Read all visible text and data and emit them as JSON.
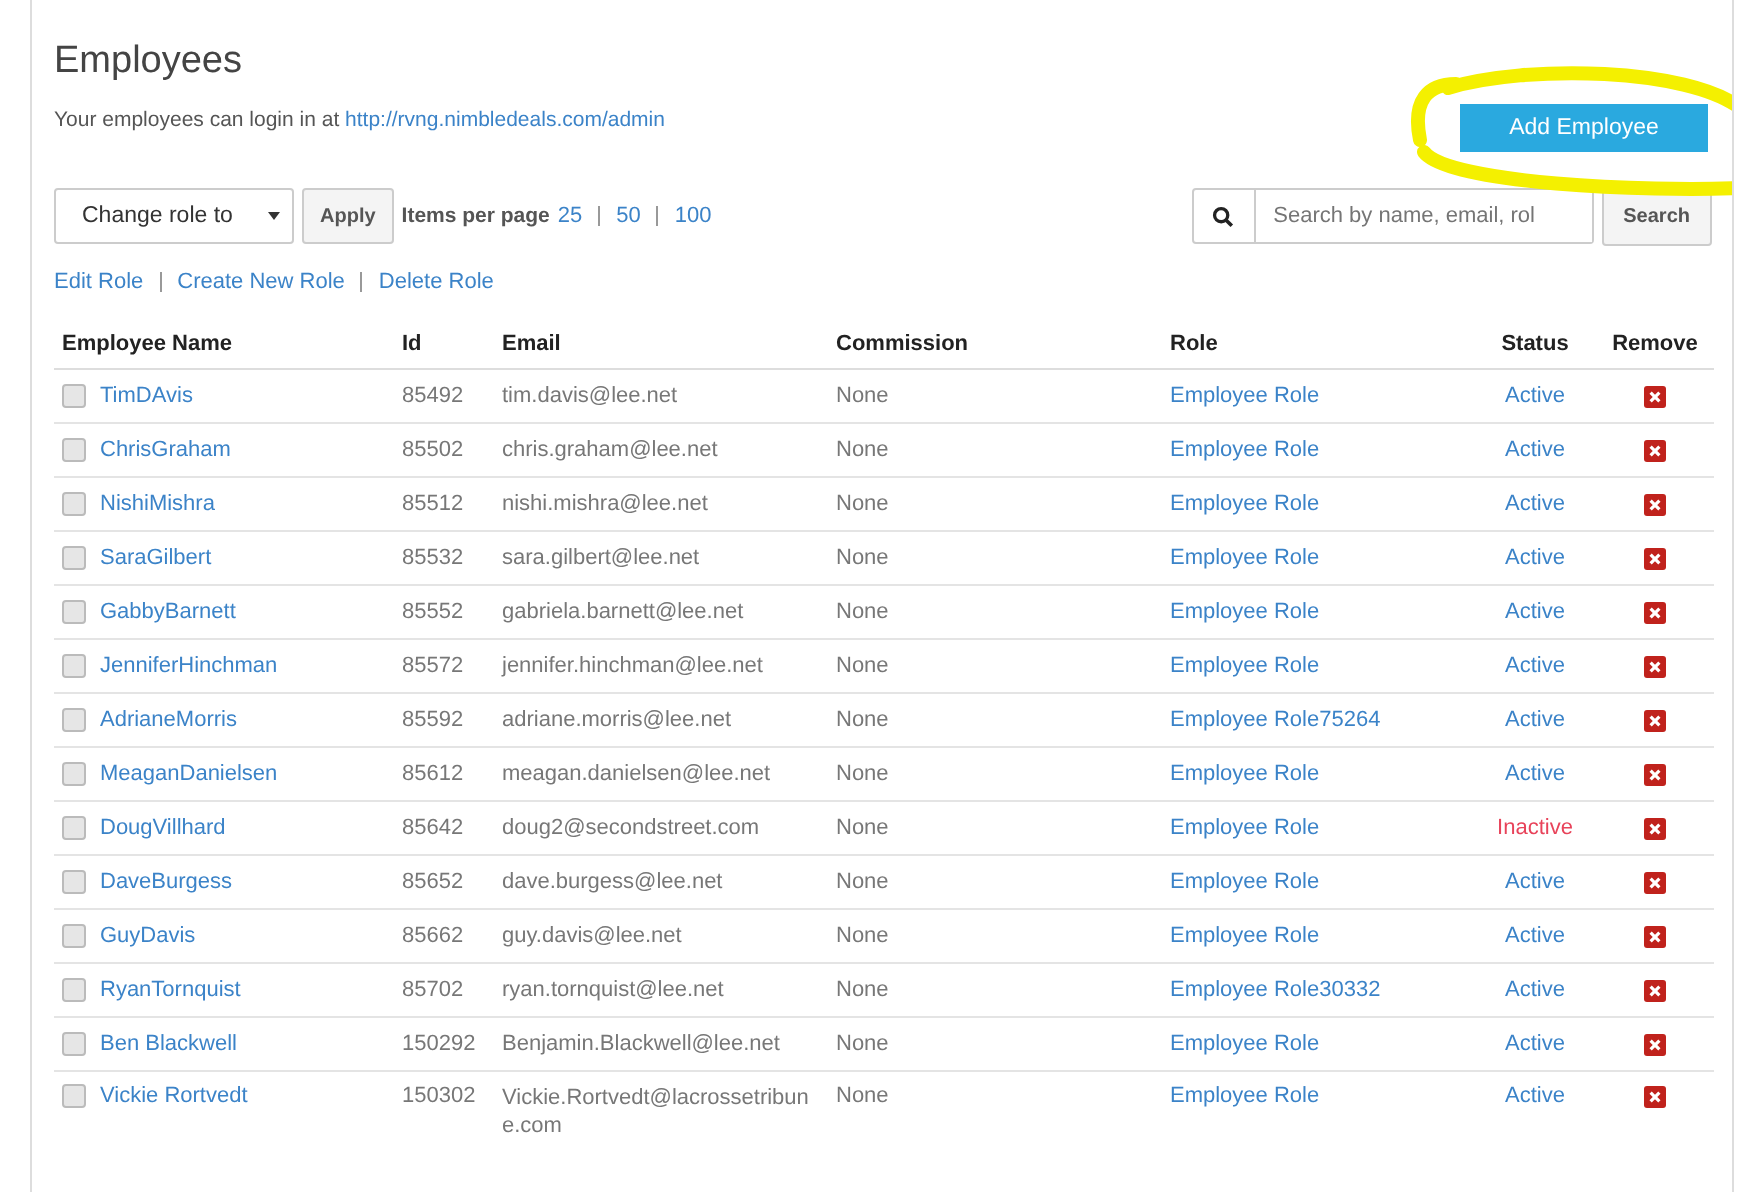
{
  "page": {
    "title": "Employees",
    "login_note": "Your employees can login in at",
    "login_link": "http://rvng.nimbledeals.com/admin",
    "add_button": "Add Employee"
  },
  "toolbar": {
    "role_select": "Change role to",
    "apply_button": "Apply",
    "items_per_page_label": "Items per page",
    "page_sizes": [
      {
        "label": "25"
      },
      {
        "label": "50"
      },
      {
        "label": "100"
      }
    ],
    "search": {
      "placeholder": "Search by name, email, rol"
    },
    "search_button": "Search"
  },
  "role_links": [
    "Edit Role",
    "Create New Role",
    "Delete Role"
  ],
  "table": {
    "columns": [
      "Employee Name",
      "Id",
      "Email",
      "Commission",
      "Role",
      "Status",
      "Remove"
    ],
    "rows": [
      {
        "checked": false,
        "name": "TimDAvis",
        "id": "85492",
        "email": "tim.davis@lee.net",
        "commission": "None",
        "role": "Employee Role",
        "status": "Active",
        "active": true
      },
      {
        "checked": false,
        "name": "ChrisGraham",
        "id": "85502",
        "email": "chris.graham@lee.net",
        "commission": "None",
        "role": "Employee Role",
        "status": "Active",
        "active": true
      },
      {
        "checked": false,
        "name": "NishiMishra",
        "id": "85512",
        "email": "nishi.mishra@lee.net",
        "commission": "None",
        "role": "Employee Role",
        "status": "Active",
        "active": true
      },
      {
        "checked": false,
        "name": "SaraGilbert",
        "id": "85532",
        "email": "sara.gilbert@lee.net",
        "commission": "None",
        "role": "Employee Role",
        "status": "Active",
        "active": true
      },
      {
        "checked": false,
        "name": "GabbyBarnett",
        "id": "85552",
        "email": "gabriela.barnett@lee.net",
        "commission": "None",
        "role": "Employee Role",
        "status": "Active",
        "active": true
      },
      {
        "checked": false,
        "name": "JenniferHinchman",
        "id": "85572",
        "email": "jennifer.hinchman@lee.net",
        "commission": "None",
        "role": "Employee Role",
        "status": "Active",
        "active": true
      },
      {
        "checked": false,
        "name": "AdrianeMorris",
        "id": "85592",
        "email": "adriane.morris@lee.net",
        "commission": "None",
        "role": "Employee Role75264",
        "status": "Active",
        "active": true
      },
      {
        "checked": false,
        "name": "MeaganDanielsen",
        "id": "85612",
        "email": "meagan.danielsen@lee.net",
        "commission": "None",
        "role": "Employee Role",
        "status": "Active",
        "active": true
      },
      {
        "checked": false,
        "name": "DougVillhard",
        "id": "85642",
        "email": "doug2@secondstreet.com",
        "commission": "None",
        "role": "Employee Role",
        "status": "Inactive",
        "active": false
      },
      {
        "checked": false,
        "name": "DaveBurgess",
        "id": "85652",
        "email": "dave.burgess@lee.net",
        "commission": "None",
        "role": "Employee Role",
        "status": "Active",
        "active": true
      },
      {
        "checked": false,
        "name": "GuyDavis",
        "id": "85662",
        "email": "guy.davis@lee.net",
        "commission": "None",
        "role": "Employee Role",
        "status": "Active",
        "active": true
      },
      {
        "checked": false,
        "name": "RyanTornquist",
        "id": "85702",
        "email": "ryan.tornquist@lee.net",
        "commission": "None",
        "role": "Employee Role30332",
        "status": "Active",
        "active": true
      },
      {
        "checked": false,
        "name": "Ben Blackwell",
        "id": "150292",
        "email": "Benjamin.Blackwell@lee.net",
        "commission": "None",
        "role": "Employee Role",
        "status": "Active",
        "active": true
      },
      {
        "checked": false,
        "name": "Vickie Rortvedt",
        "id": "150302",
        "email": "Vickie.Rortvedt@lacrossetribune.com",
        "commission": "None",
        "role": "Employee Role",
        "status": "Active",
        "active": true
      }
    ]
  }
}
